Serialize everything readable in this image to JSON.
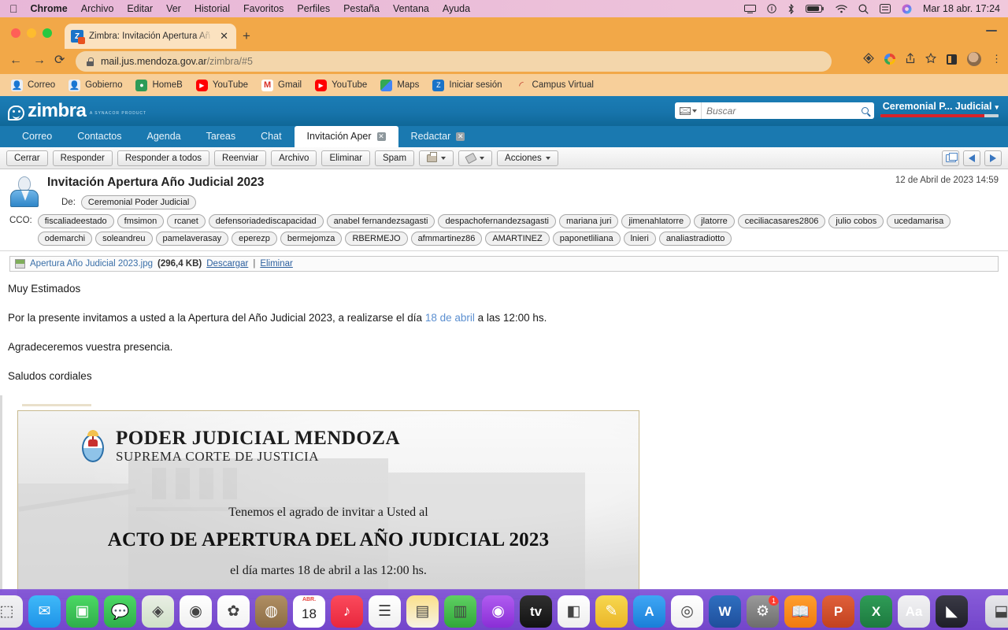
{
  "menubar": {
    "apple_icon": "apple-logo",
    "items": [
      {
        "label": "Chrome",
        "bold": true
      },
      {
        "label": "Archivo",
        "bold": false
      },
      {
        "label": "Editar",
        "bold": false
      },
      {
        "label": "Ver",
        "bold": false
      },
      {
        "label": "Historial",
        "bold": false
      },
      {
        "label": "Favoritos",
        "bold": false
      },
      {
        "label": "Perfiles",
        "bold": false
      },
      {
        "label": "Pestaña",
        "bold": false
      },
      {
        "label": "Ventana",
        "bold": false
      },
      {
        "label": "Ayuda",
        "bold": false
      }
    ],
    "status_icons": [
      "screen-mirroring-icon",
      "control-center-icon",
      "bluetooth-icon",
      "battery-icon",
      "wifi-icon",
      "spotlight-search-icon",
      "display-icon",
      "siri-icon"
    ],
    "clock": "Mar 18 abr.  17:24"
  },
  "browser": {
    "tab": {
      "title": "Zimbra: Invitación Apertura Añ",
      "favicon": "zimbra-favicon",
      "close_label": "✕"
    },
    "new_tab_label": "+",
    "nav": {
      "back": "←",
      "forward": "→",
      "reload": "⟳"
    },
    "omnibox": {
      "url_main": "mail.jus.mendoza.gov.ar",
      "url_path": "/zimbra/#5",
      "lock_icon": "lock-icon"
    },
    "toolbar_icons": [
      "extension-icon",
      "google-icon",
      "share-icon",
      "bookmark-star-icon",
      "side-panel-icon",
      "profile-avatar",
      "chrome-menu-icon"
    ],
    "bookmarks": [
      {
        "label": "Correo",
        "icon": "person-blue-icon",
        "type": "person"
      },
      {
        "label": "Gobierno",
        "icon": "person-blue-icon",
        "type": "person"
      },
      {
        "label": "HomeB",
        "icon": "green-circle-icon",
        "type": "home"
      },
      {
        "label": "YouTube",
        "icon": "youtube-icon",
        "type": "yt"
      },
      {
        "label": "Gmail",
        "icon": "gmail-icon",
        "type": "gmail"
      },
      {
        "label": "YouTube",
        "icon": "youtube-icon",
        "type": "yt"
      },
      {
        "label": "Maps",
        "icon": "maps-icon",
        "type": "maps"
      },
      {
        "label": "Iniciar sesión",
        "icon": "zimbra-icon",
        "type": "z"
      },
      {
        "label": "Campus Virtual",
        "icon": "campus-icon",
        "type": "campus"
      }
    ]
  },
  "zimbra": {
    "logo": {
      "word": "zimbra",
      "tagline": "A SYNACOR PRODUCT"
    },
    "search": {
      "placeholder": "Buscar",
      "value": "",
      "type_icon": "mail-filter-icon",
      "go_icon": "search-icon"
    },
    "user": {
      "name": "Ceremonial P... Judicial",
      "caret": "▾",
      "quota_percent": 88
    },
    "tabs": [
      {
        "label": "Correo",
        "active": false,
        "closable": false
      },
      {
        "label": "Contactos",
        "active": false,
        "closable": false
      },
      {
        "label": "Agenda",
        "active": false,
        "closable": false
      },
      {
        "label": "Tareas",
        "active": false,
        "closable": false
      },
      {
        "label": "Chat",
        "active": false,
        "closable": false
      },
      {
        "label": "Invitación Aper",
        "active": true,
        "closable": true
      },
      {
        "label": "Redactar",
        "active": false,
        "closable": true
      }
    ],
    "toolbar": {
      "buttons": [
        "Cerrar",
        "Responder",
        "Responder a todos",
        "Reenviar",
        "Archivo",
        "Eliminar",
        "Spam"
      ],
      "print_icon": "printer-icon",
      "tag_icon": "tag-icon",
      "actions_label": "Acciones",
      "right_icons": [
        "detach-window-icon",
        "previous-message-icon",
        "next-message-icon"
      ]
    },
    "message": {
      "subject": "Invitación Apertura Año Judicial 2023",
      "date": "12 de Abril de 2023 14:59",
      "from_label": "De:",
      "from_value": "Ceremonial Poder Judicial",
      "bcc_label": "CCO:",
      "bcc": [
        "fiscaliadeestado",
        "fmsimon",
        "rcanet",
        "defensoriadediscapacidad",
        "anabel fernandezsagasti",
        "despachofernandezsagasti",
        "mariana juri",
        "jimenahlatorre",
        "jlatorre",
        "ceciliacasares2806",
        "julio cobos",
        "ucedamarisa",
        "odemarchi",
        "soleandreu",
        "pamelaverasay",
        "eperezp",
        "bermejomza",
        "RBERMEJO",
        "afmmartinez86",
        "AMARTINEZ",
        "paponetliliana",
        "lnieri",
        "analiastradiotto"
      ],
      "attachment": {
        "name": "Apertura Año Judicial 2023.jpg",
        "size": "(296,4 KB)",
        "download_label": "Descargar",
        "separator": "|",
        "delete_label": "Eliminar",
        "icon": "image-attachment-icon"
      },
      "body": {
        "p1": "Muy Estimados",
        "p2_before": "Por la presente invitamos a usted a la Apertura del Año Judicial 2023, a realizarse el día ",
        "p2_link": "18 de abril",
        "p2_after": " a las 12:00 hs.",
        "p3": "Agradeceremos vuestra presencia.",
        "p4": "Saludos cordiales"
      },
      "invitation_image": {
        "crest_icon": "argentina-coat-of-arms-icon",
        "org_title": "PODER JUDICIAL MENDOZA",
        "org_subtitle": "SUPREMA CORTE DE JUSTICIA",
        "line1": "Tenemos el agrado de invitar a Usted al",
        "line2": "ACTO DE APERTURA DEL AÑO JUDICIAL 2023",
        "line3": "el día martes 18 de abril a las 12:00 hs."
      }
    }
  },
  "dock": {
    "items": [
      {
        "name": "finder",
        "glyph": "☺",
        "bg": "linear-gradient(180deg,#32b4f5,#1e8fd8)",
        "running": true
      },
      {
        "name": "safari",
        "glyph": "🧭",
        "bg": "linear-gradient(180deg,#f5f5f7,#dcdce0)",
        "running": false
      },
      {
        "name": "launchpad",
        "glyph": "⬚",
        "bg": "linear-gradient(180deg,#f2f2f4,#e2e2e6)",
        "running": false
      },
      {
        "name": "mail",
        "glyph": "✉",
        "bg": "linear-gradient(180deg,#3fb9f8,#1f93e8)",
        "running": false
      },
      {
        "name": "facetime",
        "glyph": "▣",
        "bg": "linear-gradient(180deg,#4cd964,#2fae4b)",
        "running": false
      },
      {
        "name": "messages",
        "glyph": "💬",
        "bg": "linear-gradient(180deg,#4cd964,#2fae4b)",
        "running": false
      },
      {
        "name": "maps-apple",
        "glyph": "◈",
        "bg": "linear-gradient(180deg,#e9efe4,#cfe0c8)",
        "running": false
      },
      {
        "name": "google-maps",
        "glyph": "◉",
        "bg": "linear-gradient(180deg,#ffffff,#f0f0f0)",
        "running": false
      },
      {
        "name": "photos",
        "glyph": "✿",
        "bg": "linear-gradient(180deg,#ffffff,#f2f2f2)",
        "running": false
      },
      {
        "name": "contacts",
        "glyph": "◍",
        "bg": "linear-gradient(180deg,#b08f63,#8c6c45)",
        "running": false
      },
      {
        "name": "calendar",
        "glyph": "18",
        "sub": "ABR.",
        "bg": "#ffffff",
        "running": false
      },
      {
        "name": "music",
        "glyph": "♪",
        "bg": "linear-gradient(180deg,#fb4a5c,#e8273d)",
        "running": true
      },
      {
        "name": "reminders",
        "glyph": "☰",
        "bg": "linear-gradient(180deg,#ffffff,#f0f0f0)",
        "running": false
      },
      {
        "name": "notes",
        "glyph": "▤",
        "bg": "linear-gradient(180deg,#fbe08a,#f6f2e4)",
        "running": false
      },
      {
        "name": "numbers",
        "glyph": "▥",
        "bg": "linear-gradient(180deg,#5fd063,#31a83a)",
        "running": false
      },
      {
        "name": "podcasts",
        "glyph": "◉",
        "bg": "linear-gradient(180deg,#b05cf0,#8a2ed6)",
        "running": true
      },
      {
        "name": "appletv",
        "glyph": "tv",
        "bg": "linear-gradient(180deg,#303030,#121212)",
        "running": false
      },
      {
        "name": "keynote",
        "glyph": "◧",
        "bg": "linear-gradient(180deg,#ffffff,#eeeeee)",
        "running": false
      },
      {
        "name": "freeform",
        "glyph": "✎",
        "bg": "linear-gradient(180deg,#f7d84f,#eab528)",
        "running": false
      },
      {
        "name": "appstore",
        "glyph": "A",
        "bg": "linear-gradient(180deg,#3fa7f5,#1a7fd8)",
        "running": false
      },
      {
        "name": "chrome",
        "glyph": "◎",
        "bg": "linear-gradient(180deg,#ffffff,#f0f0f0)",
        "running": true
      },
      {
        "name": "word",
        "glyph": "W",
        "bg": "linear-gradient(180deg,#2f6fc0,#1f4f9c)",
        "running": false
      },
      {
        "name": "settings",
        "glyph": "⚙",
        "bg": "linear-gradient(180deg,#9a9a9a,#6d6d6d)",
        "running": false,
        "badge": "1"
      },
      {
        "name": "books",
        "glyph": "📖",
        "bg": "linear-gradient(180deg,#ff9f2e,#f07a10)",
        "running": false
      },
      {
        "name": "powerpoint",
        "glyph": "P",
        "bg": "linear-gradient(180deg,#e0603a,#c2421f)",
        "running": false
      },
      {
        "name": "excel",
        "glyph": "X",
        "bg": "linear-gradient(180deg,#2f9c57,#1d7a3f)",
        "running": false
      },
      {
        "name": "font-book",
        "glyph": "Aa",
        "bg": "linear-gradient(180deg,#f2f2f4,#dedee2)",
        "running": false
      },
      {
        "name": "final-cut",
        "glyph": "◣",
        "bg": "linear-gradient(180deg,#3a3a46,#1f1f29)",
        "running": false
      },
      {
        "name": "separator",
        "glyph": "",
        "bg": "",
        "running": false
      },
      {
        "name": "downloads-stack",
        "glyph": "⬓",
        "bg": "linear-gradient(180deg,#e8e8ec,#cfcfd6)",
        "running": false
      },
      {
        "name": "screenshot-preview",
        "glyph": "▧",
        "bg": "linear-gradient(180deg,#d84f3a,#b0351f)",
        "running": false
      },
      {
        "name": "trash",
        "glyph": "🗑",
        "bg": "linear-gradient(180deg,#eeeef2,#d4d4da)",
        "running": false
      }
    ]
  }
}
